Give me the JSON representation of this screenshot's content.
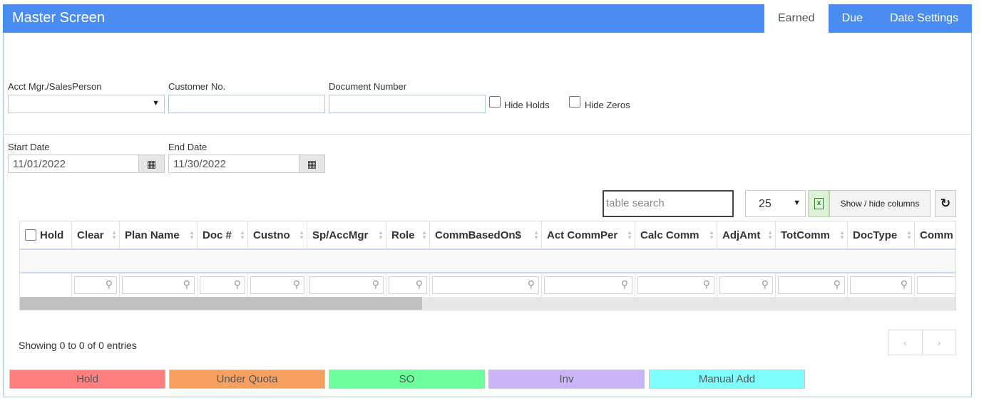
{
  "header": {
    "title": "Master Screen",
    "tabs": [
      {
        "label": "Earned",
        "active": true
      },
      {
        "label": "Due",
        "active": false
      },
      {
        "label": "Date Settings",
        "active": false
      }
    ]
  },
  "filters": {
    "acct_mgr_label": "Acct Mgr./SalesPerson",
    "acct_mgr_value": "",
    "customer_no_label": "Customer No.",
    "customer_no_value": "",
    "document_number_label": "Document Number",
    "document_number_value": "",
    "hide_holds_label": "Hide Holds",
    "hide_holds_checked": false,
    "hide_zeros_label": "Hide Zeros",
    "hide_zeros_checked": false,
    "start_date_label": "Start Date",
    "start_date_value": "11/01/2022",
    "end_date_label": "End Date",
    "end_date_value": "11/30/2022"
  },
  "toolbar": {
    "search_placeholder": "table search",
    "page_length": "25",
    "excel_icon": "excel-icon",
    "show_hide_label": "Show / hide columns",
    "refresh_icon": "refresh-icon"
  },
  "table": {
    "columns": [
      "Hold",
      "Clear",
      "Plan Name",
      "Doc #",
      "Custno",
      "Sp/AccMgr",
      "Role",
      "CommBasedOn$",
      "Act CommPer",
      "Calc Comm",
      "AdjAmt",
      "TotComm",
      "DocType",
      "Comm"
    ],
    "rows": []
  },
  "footer": {
    "info": "Showing 0 to 0 of 0 entries",
    "prev": "‹",
    "next": "›"
  },
  "legend": [
    {
      "label": "Hold",
      "color": "#ff7f7f"
    },
    {
      "label": "Under Quota",
      "color": "#f5a060"
    },
    {
      "label": "SO",
      "color": "#6dfe9b"
    },
    {
      "label": "Inv",
      "color": "#c9b4f8"
    },
    {
      "label": "Manual Add",
      "color": "#7ffdfd"
    }
  ]
}
